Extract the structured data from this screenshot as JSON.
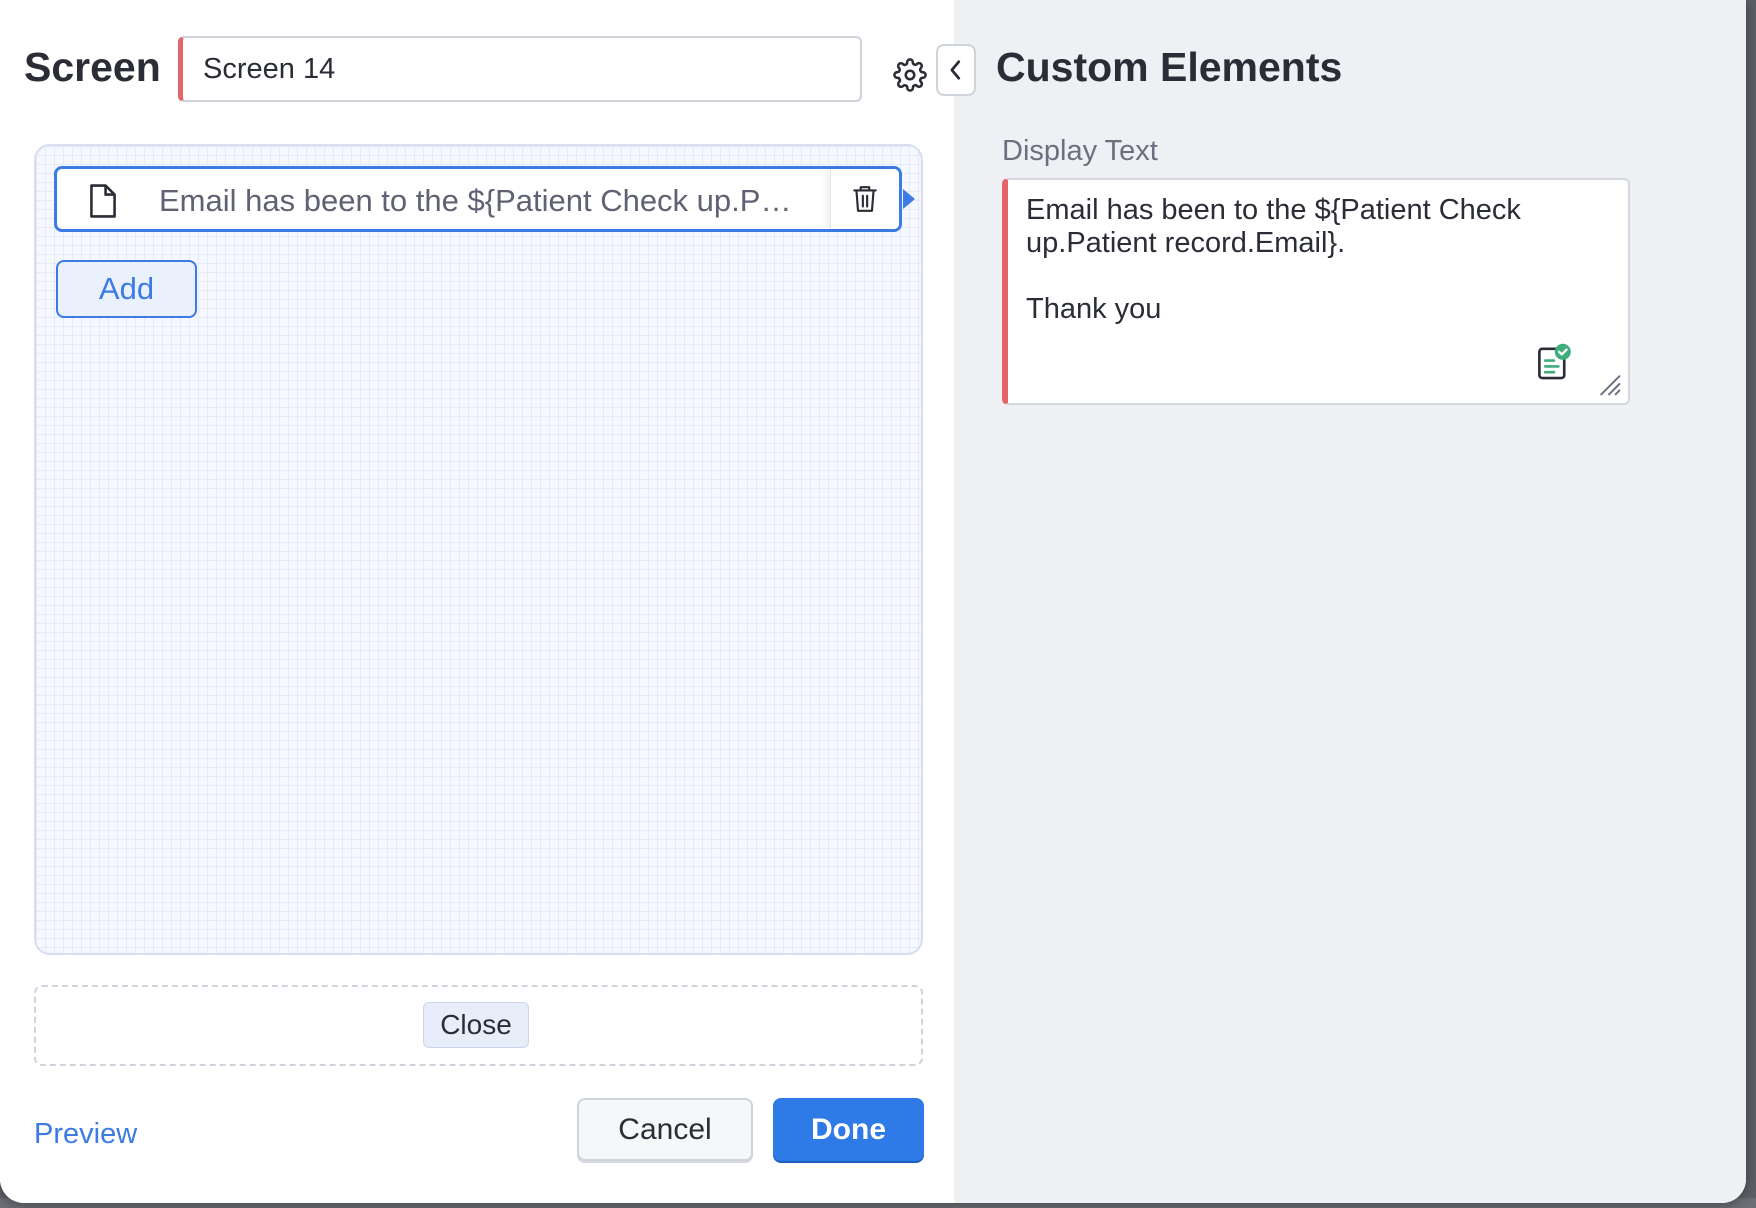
{
  "screen": {
    "title": "Screen",
    "name_value": "Screen 14"
  },
  "canvas": {
    "element_text": "Email has been to the ${Patient Check up.Pa...",
    "add_label": "Add"
  },
  "close_zone": {
    "close_label": "Close"
  },
  "footer": {
    "preview_label": "Preview",
    "cancel_label": "Cancel",
    "done_label": "Done"
  },
  "panel": {
    "title": "Custom Elements",
    "display_text_label": "Display Text",
    "display_text_value": "Email has been to the ${Patient Check up.Patient record.Email}.\n\nThank you"
  },
  "icons": {
    "settings": "gear-icon",
    "collapse": "chevron-left-icon",
    "element": "document-icon",
    "delete": "trash-icon",
    "validate": "clipboard-check-icon",
    "resize": "resize-grip-icon"
  },
  "colors": {
    "accent": "#3b7be3",
    "required_marker": "#e5646a",
    "primary_button": "#2e7ae6",
    "panel_background": "#eff0f4"
  }
}
